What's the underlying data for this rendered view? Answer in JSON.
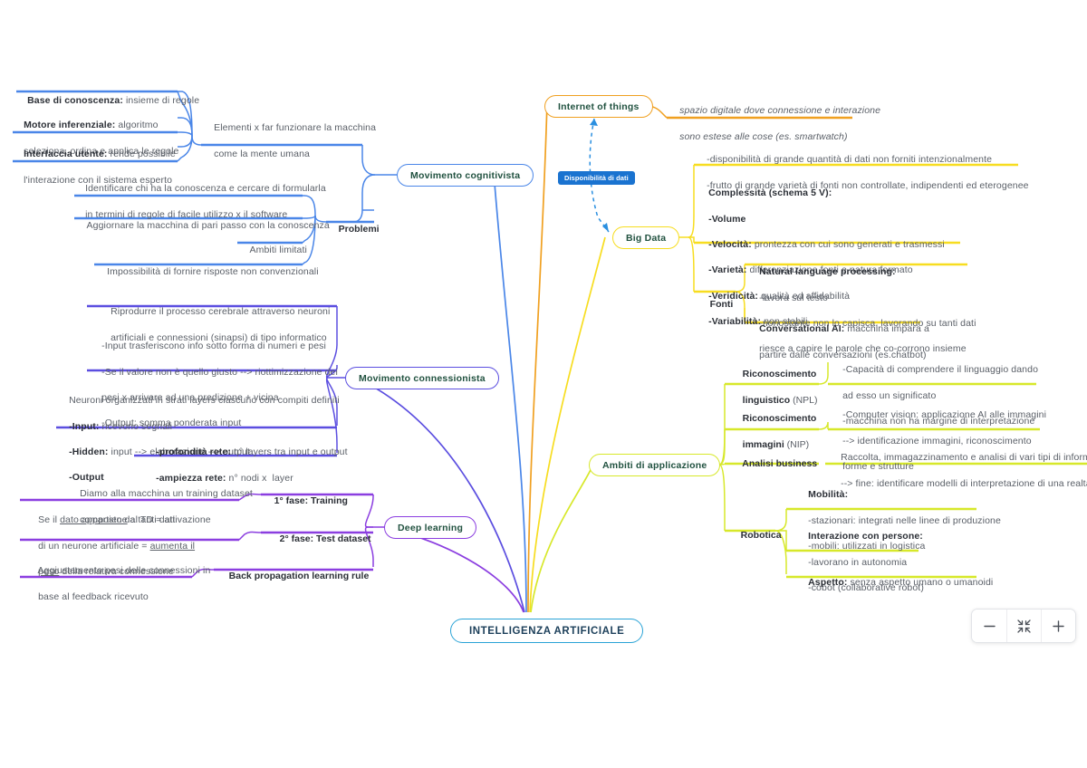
{
  "root": {
    "label": "INTELLIGENZA ARTIFICIALE"
  },
  "colors": {
    "root": "#29a3d6",
    "cognitivista": "#4a86e8",
    "internet_of_things": "#f0a020",
    "big_data": "#f7dd20",
    "ambiti": "#d7e82a",
    "connessionista": "#5b4ee0",
    "deep_learning": "#8b3ee0",
    "tag_badge": "#1a73d0",
    "leaf_text": "#5b6068",
    "bold_text": "#2b2f36",
    "node_text": "#20513f"
  },
  "branches": {
    "cognitivista": {
      "label": "Movimento cognitivista",
      "elementi": {
        "label_line1": "Elementi x far funzionare la macchina",
        "label_line2": "come la mente umana",
        "children": [
          {
            "bold": "Base di conoscenza:",
            "rest": " insieme di regole"
          },
          {
            "bold": "Motore inferenziale:",
            "rest": " algoritmo",
            "line2": "seleziona, ordina e applica le regole"
          },
          {
            "bold": "Interfaccia utente:",
            "rest": " rende possibile",
            "line2": "l'interazione con il sistema esperto"
          }
        ]
      },
      "problemi": {
        "label": "Problemi",
        "children": [
          {
            "line1": "Identificare chi ha la conoscenza e cercare di formularla",
            "line2": "in termini di regole di facile utilizzo x il software"
          },
          {
            "line1": "Aggiornare la macchina di pari passo con la conoscenza"
          },
          {
            "line1": "Ambiti limitati"
          },
          {
            "line1": "Impossibilità di fornire risposte non convenzionali"
          }
        ]
      }
    },
    "connessionista": {
      "label": "Movimento connessionista",
      "children": [
        {
          "line1": "Riprodurre il processo cerebrale attraverso neuroni",
          "line2": "artificiali e connessioni (sinapsi) di tipo informatico"
        },
        {
          "line1": "-Input trasferiscono info sotto forma di numeri e pesi",
          "line2": "-Se il valore non è quello giusto --> riottimizzazione dei",
          "line3": "pesi x arrivare ad una predizione + vicina",
          "line4": "-Output: somma ponderata input"
        },
        {
          "line1": "Neuroni organizzati in strati layers ciascuno con compiti definiti",
          "line2_bold": "-Input:",
          "line2_rest": " ricevono segnali",
          "line3_bold": "-Hidden:",
          "line3_rest": " input --> elaborazione --> output",
          "line4_bold": "-Output"
        },
        {
          "line1_bold": "-profondità rete:",
          "line1_rest": " n° layers tra input e output",
          "line2_bold": "-ampiezza rete:",
          "line2_rest": " n° nodi x  layer"
        }
      ]
    },
    "deep_learning": {
      "label": "Deep learning",
      "children": [
        {
          "label": "1° fase: Training",
          "detail_line1": "Diamo alla macchina un training dataset",
          "detail_line2": "composto da tanti dati"
        },
        {
          "label": "2° fase: Test dataset",
          "detail_line1_a": "Se il ",
          "detail_line1_u": "dato appartiene",
          "detail_line1_b": " al TD = attivazione",
          "detail_line2_a": "di un neurone artificiale = ",
          "detail_line2_u": "aumenta il",
          "detail_line3_u": "peso",
          "detail_line3_b": " della relativa connessione"
        },
        {
          "label": "Back propagation learning rule",
          "detail_line1": "Aggiustamento pesi delle connessioni in",
          "detail_line2": "base al feedback ricevuto"
        }
      ]
    },
    "internet_of_things": {
      "label": "Internet of things",
      "detail_line1": "spazio digitale dove connessione e interazione",
      "detail_line2": "sono estese alle cose (es. smartwatch)"
    },
    "disponibilita_tag": {
      "label": "Disponibilità di dati"
    },
    "big_data": {
      "label": "Big Data",
      "children": [
        {
          "line1": "-disponibilità di grande quantità di dati non forniti intenzionalmente",
          "line2": "-frutto di grande varietà di fonti non controllate, indipendenti ed eterogenee"
        },
        {
          "title": "Complessità (schema 5 V):",
          "items": [
            {
              "bold": "-Volume",
              "rest": ""
            },
            {
              "bold": "-Velocità:",
              "rest": " prontezza con cui sono generati e trasmessi"
            },
            {
              "bold": "-Varietà:",
              "rest": " differenziazione fonti e natura formato"
            },
            {
              "bold": "-Veridicità:",
              "rest": " qualità ed affidabilità"
            },
            {
              "bold": "-Variabilità:",
              "rest": " non stabili"
            }
          ]
        }
      ],
      "fonti": {
        "label": "Fonti",
        "children": [
          {
            "title": "Natural language processing:",
            "line2": "-lavora sul testo",
            "line3": "-nonostante non lo capisca, lavorando su tanti dati",
            "line4": "riesce a capire le parole che co-corrono insieme"
          },
          {
            "bold": "Conversational AI:",
            "rest": " macchina impara a",
            "line2": "partire dalle conversazioni (es.chatbot)"
          }
        ]
      }
    },
    "ambiti": {
      "label": "Ambiti di applicazione",
      "children": [
        {
          "label_line1": "Riconoscimento",
          "label_line2_bold": "linguistico",
          "label_line2_rest": " (NPL)",
          "detail_line1": "-Capacità di comprendere il linguaggio dando",
          "detail_line2": "ad esso un significato",
          "detail_line3": "-macchina non ha margine di interpretazione"
        },
        {
          "label_line1": "Riconoscimento",
          "label_line2_bold": "immagini",
          "label_line2_rest": " (NIP)",
          "detail_line1": "-Computer vision: applicazione AI alle immagini",
          "detail_line2": "--> identificazione immagini, riconoscimento",
          "detail_line3": "forme e strutture"
        },
        {
          "label_line1": "Analisi business",
          "detail_line1": "Raccolta, immagazzinamento e analisi di vari tipi di informazione",
          "detail_line2": "--> fine: identificare modelli di interpretazione di una realtà"
        },
        {
          "label_line1": "Robotica",
          "sub": [
            {
              "title": "Mobilità:",
              "line2": "-stazionari: integrati nelle linee di produzione",
              "line3": "-mobili: utilizzati in logistica"
            },
            {
              "title": "Interazione con persone:",
              "line2": "-lavorano in autonomia",
              "line3": "-cobot (collaborative robot)"
            },
            {
              "bold": "Aspetto:",
              "rest": " senza aspetto umano o umanoidi"
            }
          ]
        }
      ]
    }
  },
  "zoom_controls": {
    "zoom_out_label": "−",
    "fit_label": "fit-screen-icon",
    "zoom_in_label": "+"
  }
}
